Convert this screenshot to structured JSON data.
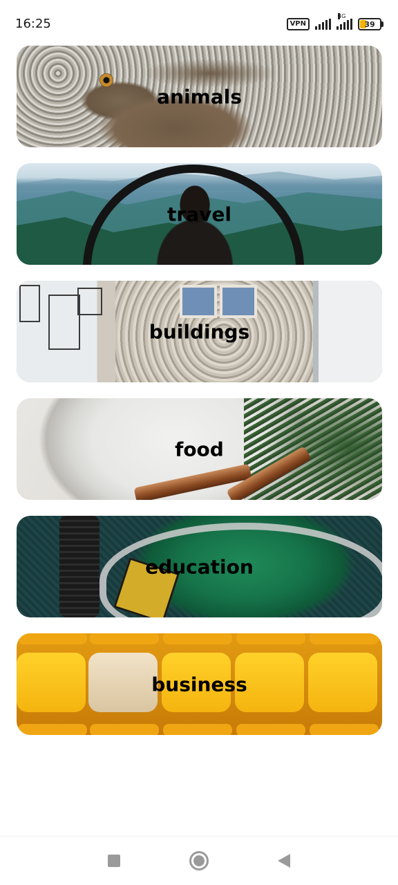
{
  "status_bar": {
    "time": "16:25",
    "vpn": "VPN",
    "network": "4G",
    "battery": "39",
    "icons": [
      "vpn-icon",
      "signal-icon",
      "signal-4g-icon",
      "battery-icon"
    ]
  },
  "categories": [
    {
      "label": "animals",
      "image": "hare-photo"
    },
    {
      "label": "travel",
      "image": "mountain-arch-photo"
    },
    {
      "label": "buildings",
      "image": "shell-facade-photo"
    },
    {
      "label": "food",
      "image": "bowl-cinnamon-photo"
    },
    {
      "label": "education",
      "image": "crest-patch-photo"
    },
    {
      "label": "business",
      "image": "lego-heads-photo"
    }
  ],
  "nav_bar": {
    "icons": [
      "recent-apps-icon",
      "home-icon",
      "back-icon"
    ]
  }
}
